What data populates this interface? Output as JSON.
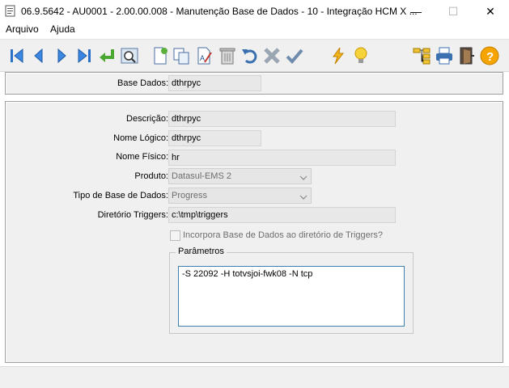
{
  "window": {
    "title": "06.9.5642 - AU0001 - 2.00.00.008 - Manutenção Base de Dados - 10 - Integração HCM X ...",
    "minimize": "—",
    "maximize": "☐",
    "close": "✕"
  },
  "menu": {
    "items": [
      "Arquivo",
      "Ajuda"
    ]
  },
  "toolbar": {
    "icons": [
      "first-icon",
      "previous-icon",
      "next-icon",
      "last-icon",
      "goto-icon",
      "search-icon",
      "new-icon",
      "copy-icon",
      "edit-icon",
      "delete-icon",
      "undo-icon",
      "cancel-icon",
      "save-icon",
      "execute-icon",
      "tip-icon",
      "structure-icon",
      "print-icon",
      "exit-icon",
      "help-icon"
    ]
  },
  "header": {
    "base_dados_label": "Base Dados:",
    "base_dados_value": "dthrpyc"
  },
  "form": {
    "descricao_label": "Descrição:",
    "descricao_value": "dthrpyc",
    "nome_logico_label": "Nome Lógico:",
    "nome_logico_value": "dthrpyc",
    "nome_fisico_label": "Nome Físico:",
    "nome_fisico_value": "hr",
    "produto_label": "Produto:",
    "produto_value": "Datasul-EMS 2",
    "tipo_label": "Tipo de Base de Dados:",
    "tipo_value": "Progress",
    "diretorio_label": "Diretório Triggers:",
    "diretorio_value": "c:\\tmp\\triggers",
    "incorpora_label": "Incorpora Base de Dados ao diretório de Triggers?",
    "incorpora_checked": false,
    "parametros_title": "Parâmetros",
    "parametros_value": "-S 22092 -H totvsjoi-fwk08 -N tcp"
  },
  "colors": {
    "accent": "#3c7fb1",
    "panel": "#f0f0f0"
  }
}
